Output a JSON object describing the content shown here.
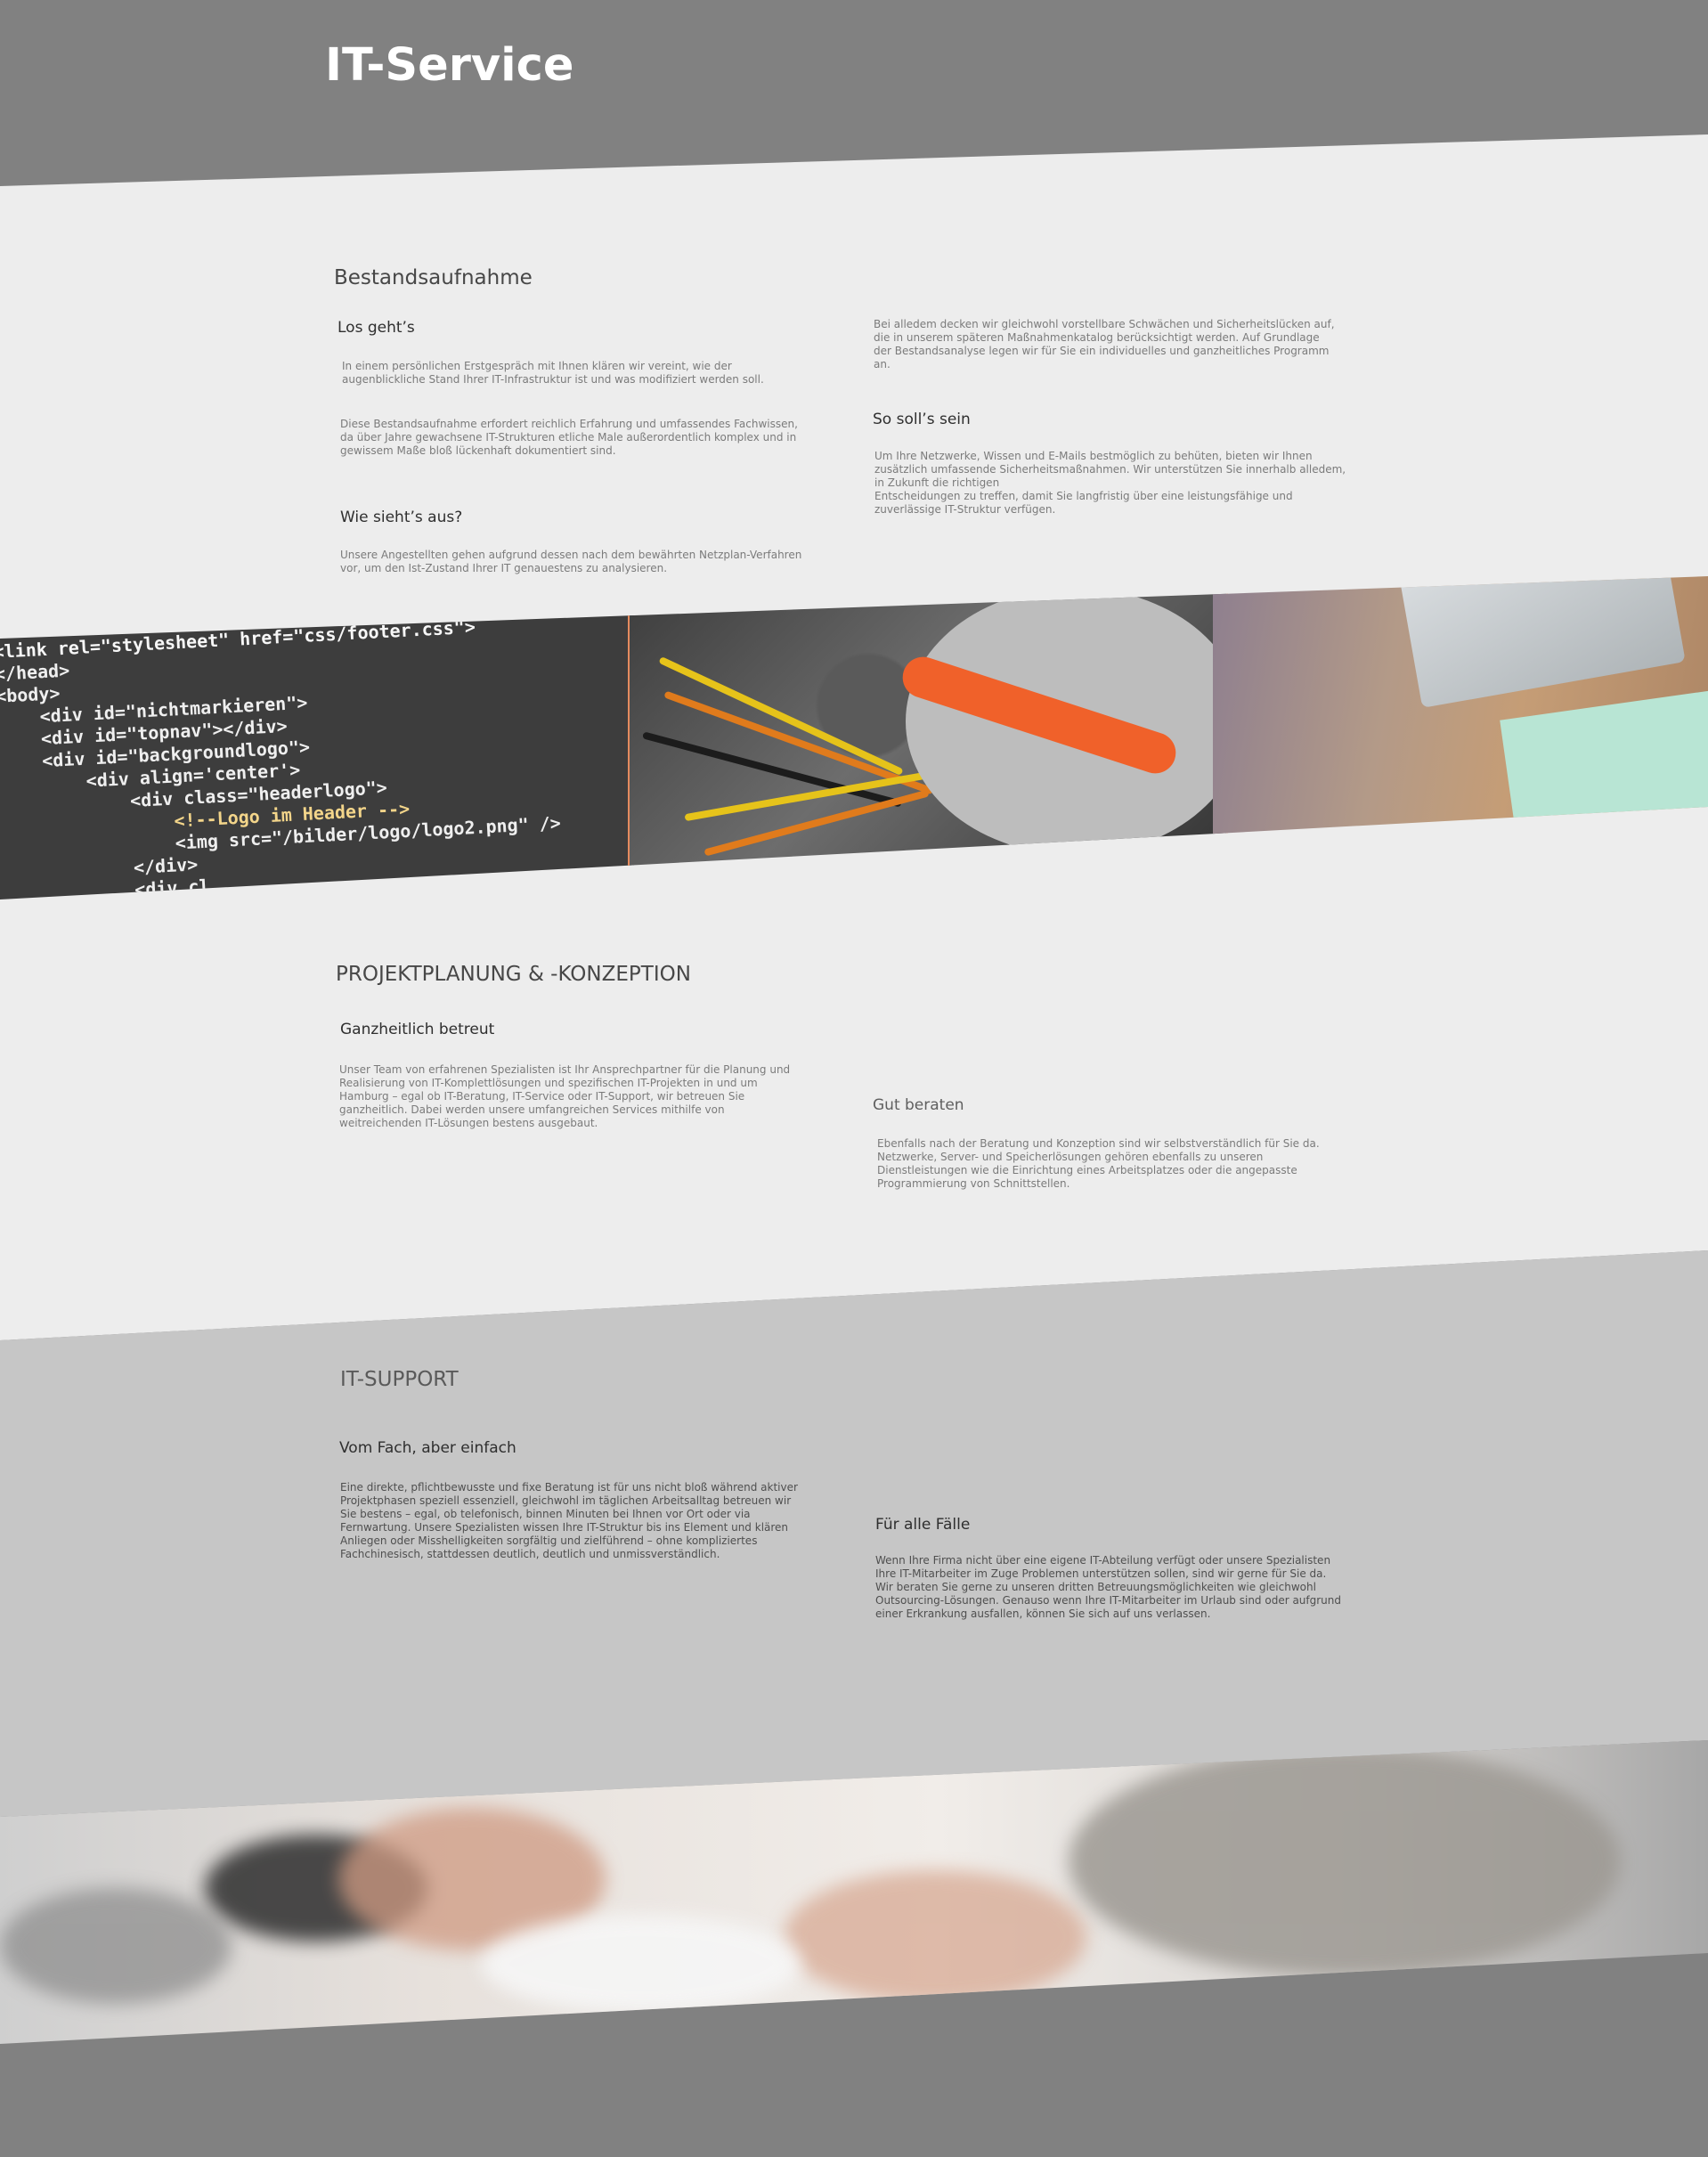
{
  "header": {
    "site_title": "IT-Service"
  },
  "bestandsaufnahme": {
    "title": "Bestandsaufnahme",
    "los_gehts": {
      "heading": "Los geht’s",
      "para1": "In einem persönlichen Erstgespräch mit Ihnen klären wir vereint, wie der augenblickliche Stand Ihrer IT-Infrastruktur ist und was modifiziert werden soll.",
      "para2": "Diese Bestandsaufnahme erfordert reichlich Erfahrung und umfassendes Fachwissen, da über Jahre gewachsene IT-Strukturen etliche Male außerordentlich komplex und in gewissem Maße bloß lückenhaft dokumentiert sind."
    },
    "wie_siehts_aus": {
      "heading": "Wie sieht’s aus?",
      "text": "Unsere Angestellten gehen aufgrund dessen nach dem bewährten Netzplan-Verfahren vor, um den Ist-Zustand Ihrer IT genauestens zu analysieren."
    },
    "right_intro": "Bei alledem decken wir gleichwohl vorstellbare Schwächen und Sicherheitslücken auf, die in unserem späteren Maßnahmenkatalog berücksichtigt werden. Auf Grundlage der Bestandsanalyse legen wir für Sie ein individuelles und ganzheitliches Programm an.",
    "so_solls_sein": {
      "heading": "So soll’s sein",
      "text": "Um Ihre Netzwerke, Wissen und E-Mails bestmöglich zu behüten, bieten wir Ihnen zusätzlich umfassende Sicherheitsmaßnahmen. Wir unterstützen Sie innerhalb alledem, in Zukunft die richtigen\nEntscheidungen zu treffen, damit Sie langfristig über eine leistungsfähige und zuverlässige IT-Struktur verfügen."
    }
  },
  "code_photo": {
    "line1": "<link rel=\"stylesheet\" href=\"css/footer.css\">",
    "line2": "</head>",
    "line3": "<body>",
    "line4": "    <div id=\"nichtmarkieren\">",
    "line5": "    <div id=\"topnav\"></div>",
    "line6": "    <div id=\"backgroundlogo\">",
    "line7": "        <div align='center'>",
    "line8": "            <div class=\"headerlogo\">",
    "line9": "                <!--Logo im Header -->",
    "line10": "                <img src=\"/bilder/logo/logo2.png\" />",
    "line11": "            </div>",
    "line12": "            <div cl..."
  },
  "projektplanung": {
    "title": "PROJEKTPLANUNG & -KONZEPTION",
    "ganzheitlich": {
      "heading": "Ganzheitlich betreut",
      "text": "Unser Team von erfahrenen Spezialisten ist Ihr Ansprechpartner für die Planung und Realisierung von IT-Komplettlösungen und spezifischen IT-Projekten in und um Hamburg – egal ob IT-Beratung, IT-Service oder IT-Support, wir betreuen Sie ganzheitlich. Dabei werden unsere umfangreichen Services mithilfe von weitreichenden IT-Lösungen bestens ausgebaut."
    },
    "gut_beraten": {
      "heading": "Gut beraten",
      "text": "Ebenfalls nach der Beratung und Konzeption sind wir selbstverständlich für Sie da. Netzwerke, Server- und Speicherlösungen gehören ebenfalls zu unseren Dienstleistungen wie die Einrichtung eines Arbeitsplatzes oder die angepasste Programmierung von Schnittstellen."
    }
  },
  "it_support": {
    "title": "IT-SUPPORT",
    "vom_fach": {
      "heading": "Vom Fach, aber einfach",
      "text": "Eine direkte, pflichtbewusste und fixe Beratung ist für uns nicht bloß während aktiver Projektphasen speziell essenziell, gleichwohl im täglichen Arbeitsalltag betreuen wir Sie bestens – egal, ob telefonisch, binnen Minuten bei Ihnen vor Ort oder via Fernwartung. Unsere Spezialisten wissen Ihre IT-Struktur bis ins Element und klären Anliegen oder Misshelligkeiten sorgfältig und zielführend – ohne kompliziertes Fachchinesisch, stattdessen deutlich, deutlich und unmissverständlich."
    },
    "fuer_alle_faelle": {
      "heading": "Für alle Fälle",
      "text": "Wenn Ihre Firma nicht über eine eigene IT-Abteilung verfügt oder unsere Spezialisten Ihre IT-Mitarbeiter im Zuge Problemen unterstützen sollen, sind wir gerne für Sie da.\nWir beraten Sie gerne zu unseren dritten Betreuungsmöglichkeiten wie gleichwohl Outsourcing-Lösungen. Genauso wenn Ihre IT-Mitarbeiter im Urlaub sind oder aufgrund einer Erkrankung ausfallen, können Sie sich auf uns verlassen."
    }
  },
  "colors": {
    "header_bg": "#818181",
    "light_band": "#ededed",
    "support_band": "#c6c6c6",
    "accent_orange": "#f0612a"
  }
}
